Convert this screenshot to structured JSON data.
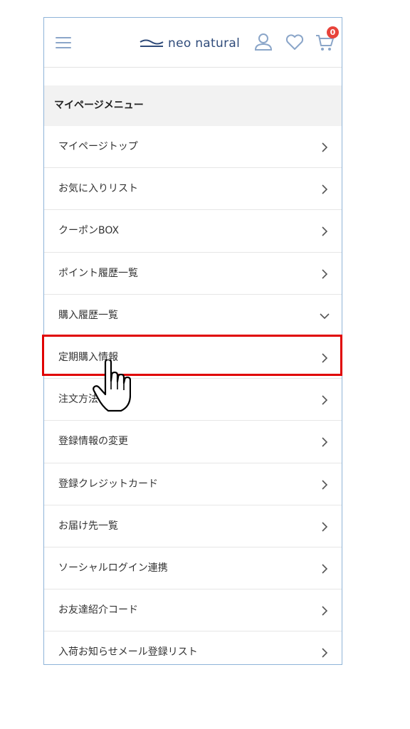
{
  "header": {
    "logo_text": "neo natural",
    "menu_icon": "hamburger-icon",
    "account_icon": "user-icon",
    "favorites_icon": "heart-icon",
    "cart_icon": "cart-icon",
    "cart_count": "0"
  },
  "menu": {
    "title": "マイページメニュー",
    "items": [
      {
        "label": "マイページトップ",
        "icon": "chevron-right-icon"
      },
      {
        "label": "お気に入りリスト",
        "icon": "chevron-right-icon"
      },
      {
        "label": "クーポンBOX",
        "icon": "chevron-right-icon"
      },
      {
        "label": "ポイント履歴一覧",
        "icon": "chevron-right-icon"
      },
      {
        "label": "購入履歴一覧",
        "icon": "chevron-down-icon"
      },
      {
        "label": "定期購入情報",
        "icon": "chevron-right-icon"
      },
      {
        "label": "注文方法の保存",
        "icon": "chevron-right-icon"
      },
      {
        "label": "登録情報の変更",
        "icon": "chevron-right-icon"
      },
      {
        "label": "登録クレジットカード",
        "icon": "chevron-right-icon"
      },
      {
        "label": "お届け先一覧",
        "icon": "chevron-right-icon"
      },
      {
        "label": "ソーシャルログイン連携",
        "icon": "chevron-right-icon"
      },
      {
        "label": "お友達紹介コード",
        "icon": "chevron-right-icon"
      },
      {
        "label": "入荷お知らせメール登録リスト",
        "icon": "chevron-right-icon"
      }
    ]
  },
  "colors": {
    "accent": "#2f4b7a",
    "icon": "#8ba6c9",
    "highlight": "#e00000",
    "badge": "#e8433a"
  }
}
